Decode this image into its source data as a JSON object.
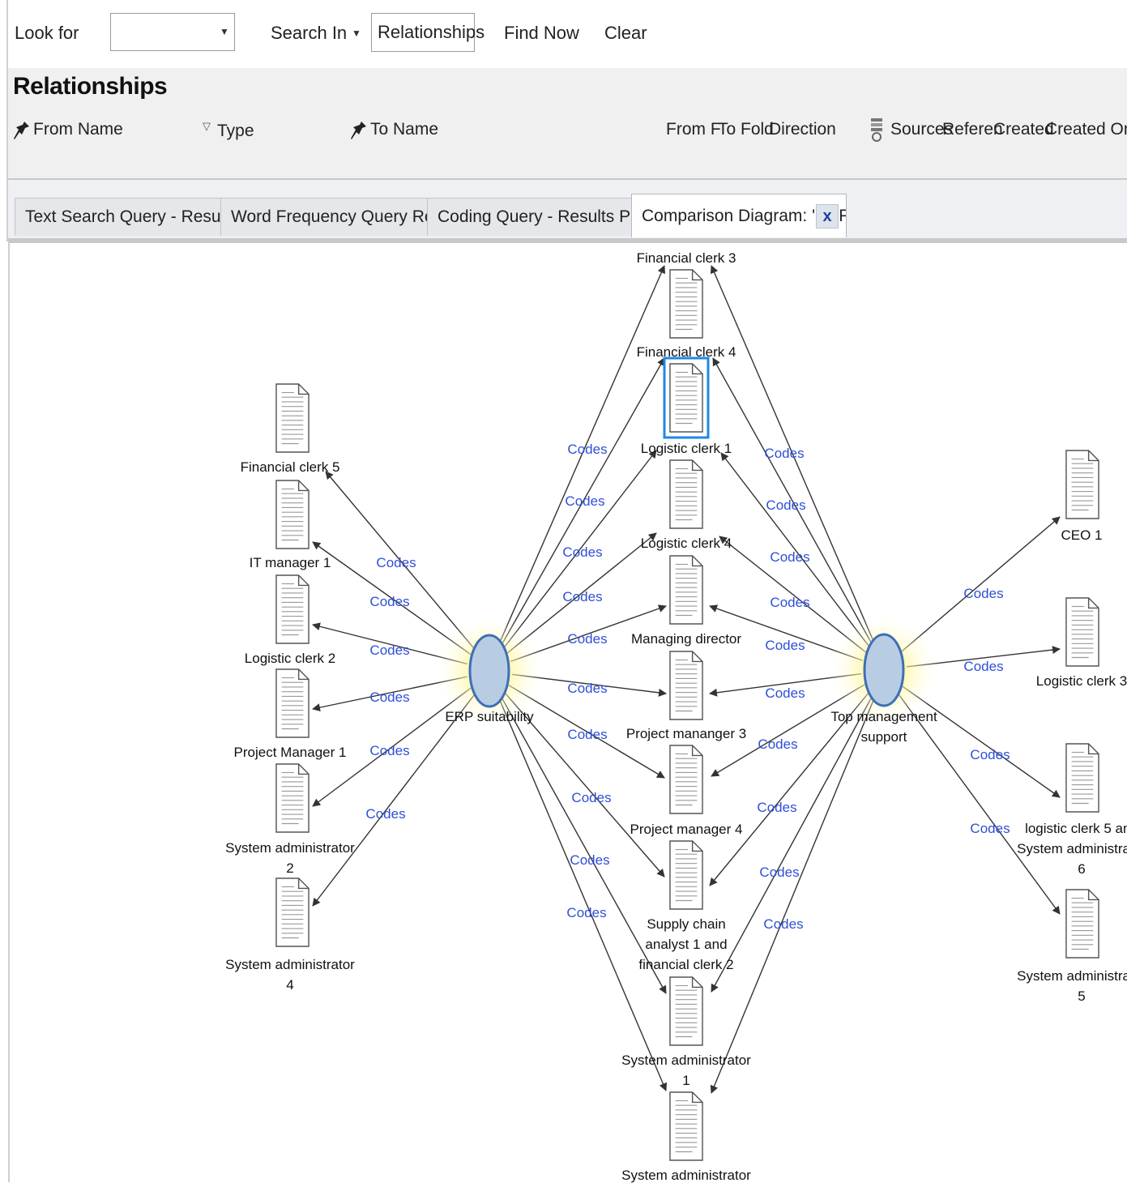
{
  "search": {
    "look_for_label": "Look for",
    "look_for_value": "",
    "search_in_label": "Search In",
    "search_in_value": "Relationships",
    "find_now_label": "Find Now",
    "clear_label": "Clear"
  },
  "relationships": {
    "title": "Relationships",
    "columns": [
      "From Name",
      "Type",
      "To Name",
      "From F",
      "To Fold",
      "Direction",
      "Sources",
      "Referen",
      "Created",
      "Created On"
    ]
  },
  "tabs": [
    {
      "label": "Text Search Query - Results P",
      "icon": "text-search-icon",
      "active": false
    },
    {
      "label": "Word Frequency Query Result",
      "icon": "word-frequency-icon",
      "active": false
    },
    {
      "label": "Coding Query - Results Previe",
      "icon": "coding-query-icon",
      "active": false
    },
    {
      "label": "Comparison Diagram: 'ERP sui",
      "icon": "comparison-diagram-icon",
      "active": true
    }
  ],
  "tab_close_label": "x",
  "diagram": {
    "edge_label": "Codes",
    "colors": {
      "node_fill": "#b8cde3",
      "node_stroke": "#3d6fb6",
      "glow": "#fff36a",
      "edge": "#333333",
      "edge_label": "#2f4fd6",
      "selection": "#1e88e5"
    },
    "nodes": [
      {
        "id": "erp",
        "label": [
          "ERP suitability"
        ]
      },
      {
        "id": "tms",
        "label": [
          "Top management",
          "support"
        ]
      }
    ],
    "documents": [
      {
        "id": "fc5",
        "label": [
          "Financial clerk 5"
        ]
      },
      {
        "id": "itm1",
        "label": [
          "IT  manager 1"
        ]
      },
      {
        "id": "lc2",
        "label": [
          "Logistic clerk 2"
        ]
      },
      {
        "id": "pm1",
        "label": [
          "Project Manager 1"
        ]
      },
      {
        "id": "sa2",
        "label": [
          "System administrator",
          "2"
        ]
      },
      {
        "id": "sa4",
        "label": [
          "System administrator",
          "4"
        ]
      },
      {
        "id": "fc3",
        "label": [
          "Financial clerk 3"
        ]
      },
      {
        "id": "fc4",
        "label": [
          "Financial clerk 4"
        ],
        "selected": true
      },
      {
        "id": "lc1",
        "label": [
          "Logistic clerk 1"
        ]
      },
      {
        "id": "lc4",
        "label": [
          "Logistic clerk 4"
        ]
      },
      {
        "id": "md",
        "label": [
          "Managing director"
        ]
      },
      {
        "id": "pm3",
        "label": [
          "Project mananger 3"
        ]
      },
      {
        "id": "pm4",
        "label": [
          "Project manager 4"
        ]
      },
      {
        "id": "sca",
        "label": [
          "Supply chain",
          "analyst 1 and",
          "financial clerk 2"
        ]
      },
      {
        "id": "sa1",
        "label": [
          "System administrator",
          "1"
        ]
      },
      {
        "id": "sa",
        "label": [
          "System administrator"
        ]
      },
      {
        "id": "ceo1",
        "label": [
          "CEO 1"
        ]
      },
      {
        "id": "lc3",
        "label": [
          "Logistic clerk 3"
        ]
      },
      {
        "id": "lc5sa6",
        "label": [
          "logistic clerk 5 and",
          "System administrator",
          "6"
        ]
      },
      {
        "id": "sa5",
        "label": [
          "System administrator",
          "5"
        ]
      }
    ]
  }
}
